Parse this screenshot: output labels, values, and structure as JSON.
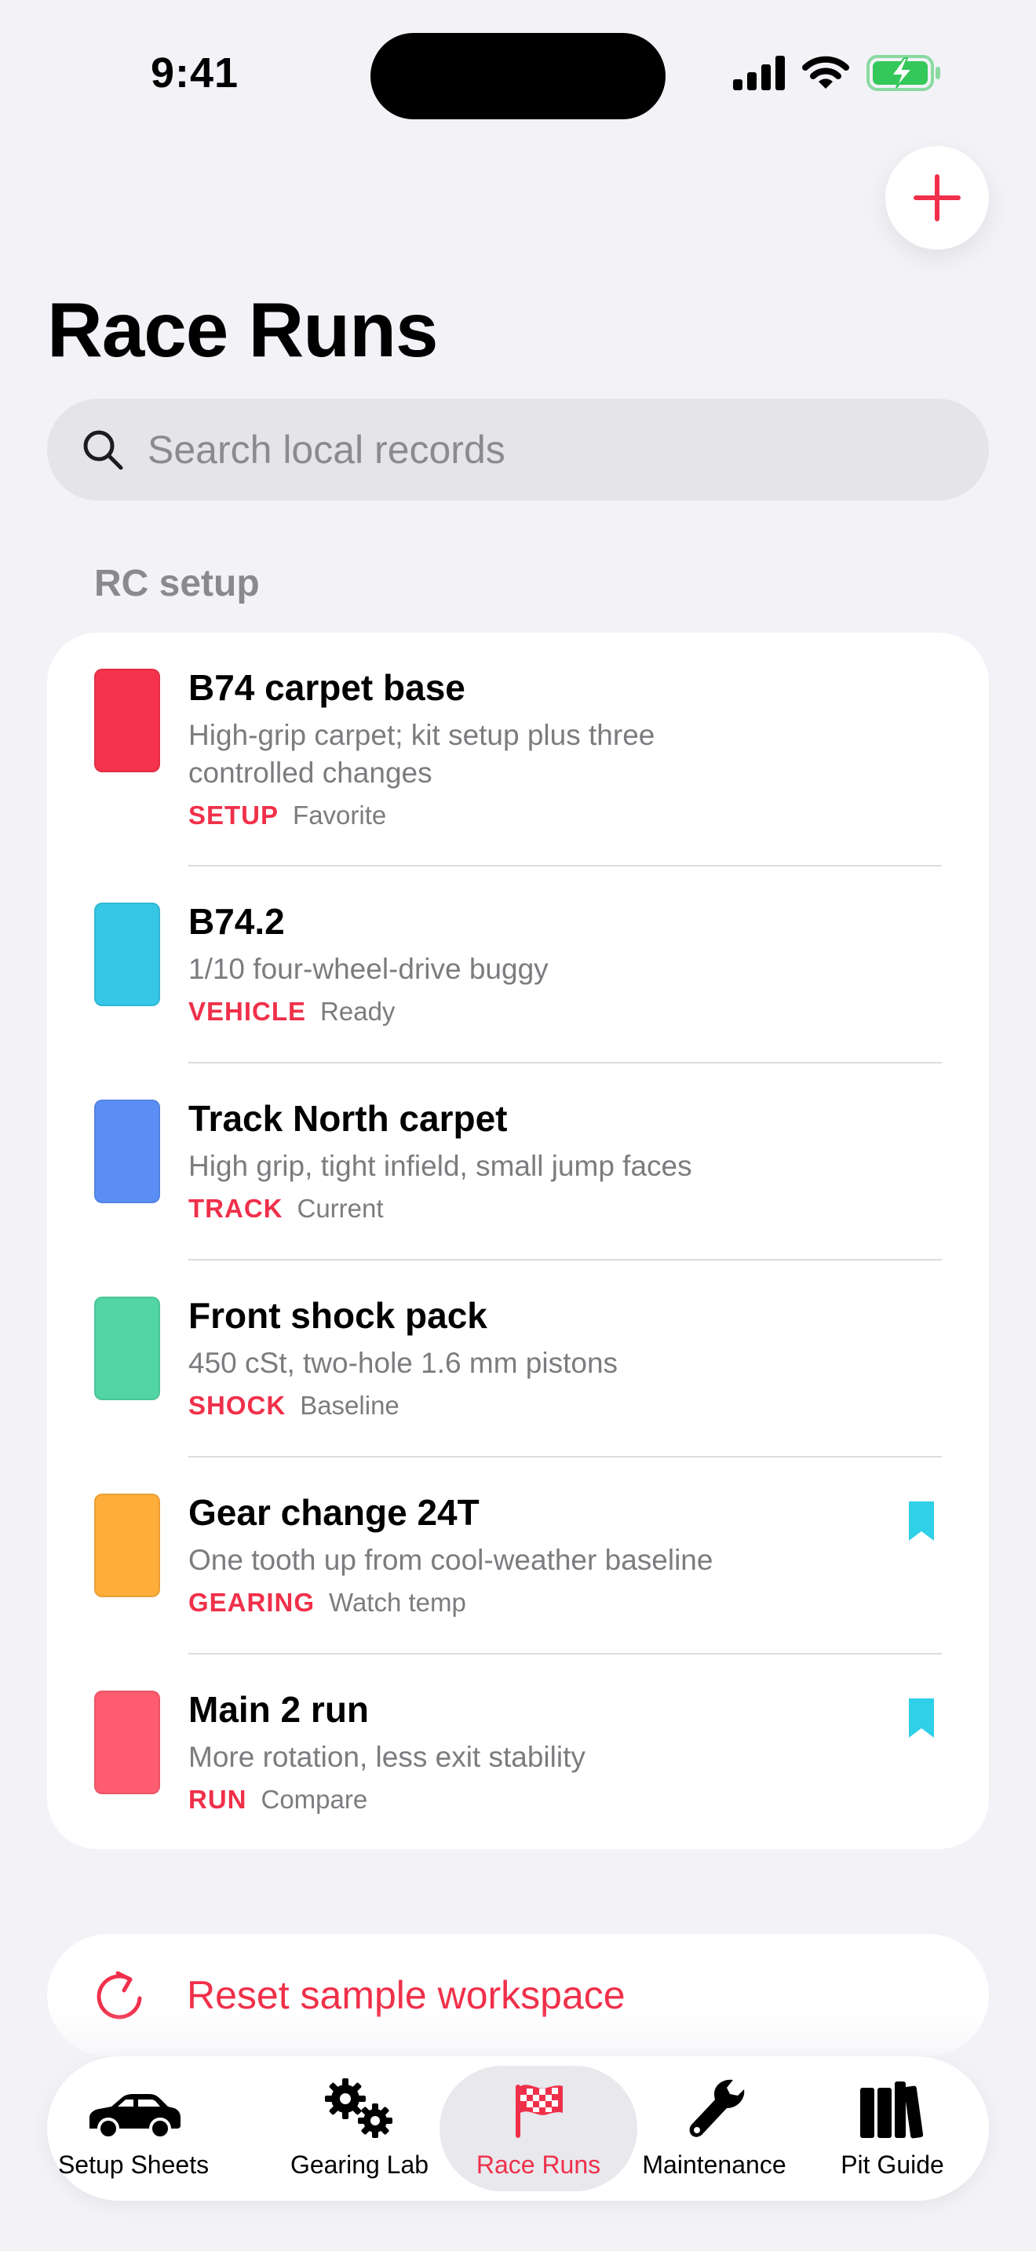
{
  "status_bar": {
    "time": "9:41"
  },
  "colors": {
    "accent": "#f0304a",
    "bookmark": "#2fd0e8"
  },
  "page": {
    "title": "Race Runs"
  },
  "search": {
    "placeholder": "Search local records",
    "value": ""
  },
  "section": {
    "header": "RC setup"
  },
  "records": [
    {
      "title": "B74 carpet base",
      "subtitle": "High-grip carpet; kit setup plus three controlled changes",
      "tag": "SETUP",
      "status": "Favorite",
      "color": "#f5334d",
      "bookmarked": false
    },
    {
      "title": "B74.2",
      "subtitle": "1/10 four-wheel-drive buggy",
      "tag": "VEHICLE",
      "status": "Ready",
      "color": "#36c6e6",
      "bookmarked": false
    },
    {
      "title": "Track North carpet",
      "subtitle": "High grip, tight infield, small jump faces",
      "tag": "TRACK",
      "status": "Current",
      "color": "#5b8ef5",
      "bookmarked": false
    },
    {
      "title": "Front shock pack",
      "subtitle": "450 cSt, two-hole 1.6 mm pistons",
      "tag": "SHOCK",
      "status": "Baseline",
      "color": "#52d4a4",
      "bookmarked": false
    },
    {
      "title": "Gear change 24T",
      "subtitle": "One tooth up from cool-weather baseline",
      "tag": "GEARING",
      "status": "Watch temp",
      "color": "#ffad3b",
      "bookmarked": true
    },
    {
      "title": "Main 2 run",
      "subtitle": "More rotation, less exit stability",
      "tag": "RUN",
      "status": "Compare",
      "color": "#ff5c70",
      "bookmarked": true
    }
  ],
  "reset": {
    "label": "Reset sample workspace"
  },
  "tabs": [
    {
      "label": "Setup Sheets",
      "icon": "car-icon",
      "active": false
    },
    {
      "label": "Gearing Lab",
      "icon": "gears-icon",
      "active": false
    },
    {
      "label": "Race Runs",
      "icon": "checkered-flag-icon",
      "active": true
    },
    {
      "label": "Maintenance",
      "icon": "wrench-icon",
      "active": false
    },
    {
      "label": "Pit Guide",
      "icon": "books-icon",
      "active": false
    }
  ]
}
